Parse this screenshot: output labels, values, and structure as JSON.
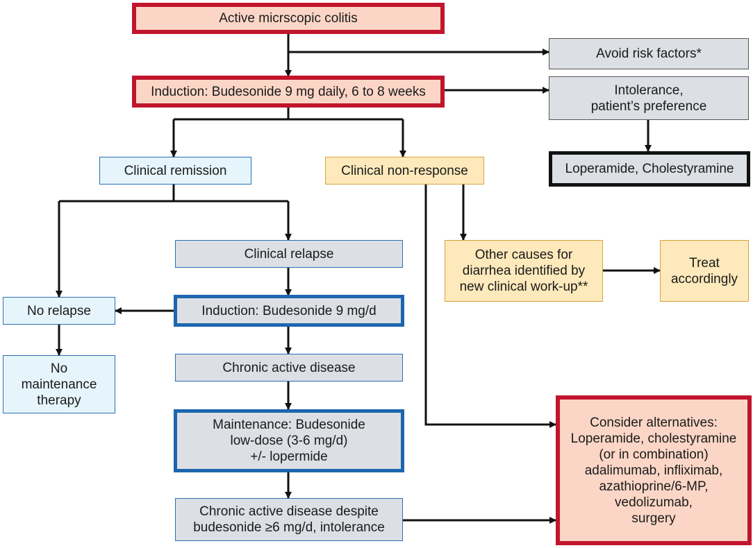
{
  "colors": {
    "red_border": "#c1152e",
    "red_fill": "#fbd6c6",
    "blue_border": "#1c66ae",
    "light_blue_fill": "#e6f5fc",
    "yellow_fill": "#fde9bb",
    "gray_fill": "#dcdfe4",
    "arrow": "#111111"
  },
  "nodes": {
    "active": "Active micrscopic colitis",
    "induction": "Induction: Budesonide 9 mg daily, 6 to 8 weeks",
    "avoid": "Avoid risk factors*",
    "intolerance": "Intolerance,\npatient’s preference",
    "loperamide": "Loperamide, Cholestyramine",
    "remission": "Clinical remission",
    "nonresponse": "Clinical non-response",
    "relapse": "Clinical relapse",
    "other_causes": "Other causes for\ndiarrhea identified by\nnew clinical work-up**",
    "treat": "Treat\naccordingly",
    "no_relapse": "No relapse",
    "induction2": "Induction: Budesonide 9 mg/d",
    "no_maintenance": "No\nmaintenance\ntherapy",
    "chronic": "Chronic active disease",
    "maintenance": "Maintenance: Budesonide\nlow-dose (3-6 mg/d)\n+/- lopermide",
    "chronic_despite": "Chronic active disease despite\nbudesonide ≥6 mg/d, intolerance",
    "alternatives": "Consider alternatives:\nLoperamide, cholestyramine\n(or in combination)\nadalimumab, infliximab,\nazathioprine/6-MP,\nvedolizumab,\nsurgery"
  }
}
